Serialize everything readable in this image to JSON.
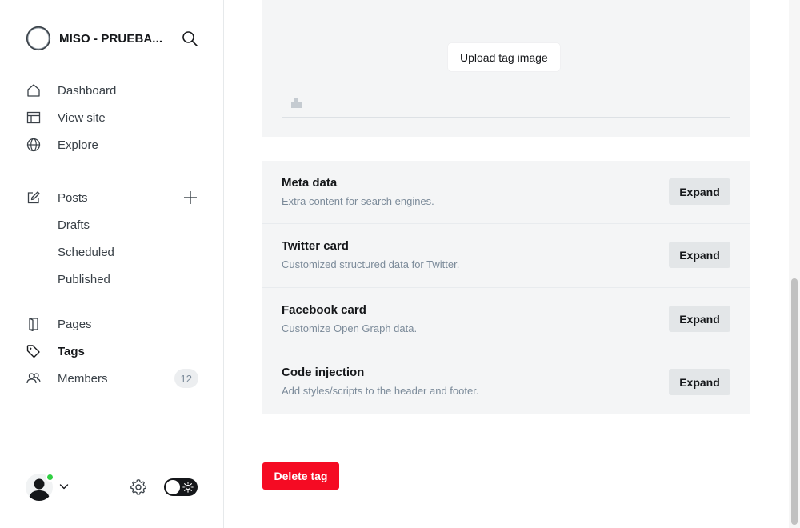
{
  "sidebar": {
    "site_title": "MISO - PRUEBA...",
    "nav_top": [
      {
        "label": "Dashboard",
        "icon": "home-icon"
      },
      {
        "label": "View site",
        "icon": "layout-icon"
      },
      {
        "label": "Explore",
        "icon": "globe-icon"
      }
    ],
    "posts": {
      "label": "Posts",
      "sub": [
        "Drafts",
        "Scheduled",
        "Published"
      ]
    },
    "nav_bottom": [
      {
        "label": "Pages",
        "icon": "pages-icon"
      },
      {
        "label": "Tags",
        "icon": "tag-icon",
        "active": true
      },
      {
        "label": "Members",
        "icon": "members-icon",
        "badge": "12"
      }
    ]
  },
  "main": {
    "upload_label": "Upload tag image",
    "sections": [
      {
        "title": "Meta data",
        "desc": "Extra content for search engines.",
        "button": "Expand"
      },
      {
        "title": "Twitter card",
        "desc": "Customized structured data for Twitter.",
        "button": "Expand"
      },
      {
        "title": "Facebook card",
        "desc": "Customize Open Graph data.",
        "button": "Expand"
      },
      {
        "title": "Code injection",
        "desc": "Add styles/scripts to the header and footer.",
        "button": "Expand"
      }
    ],
    "delete_label": "Delete tag"
  },
  "colors": {
    "danger": "#f50b23",
    "online": "#30cf43",
    "card_bg": "#f4f5f6"
  }
}
